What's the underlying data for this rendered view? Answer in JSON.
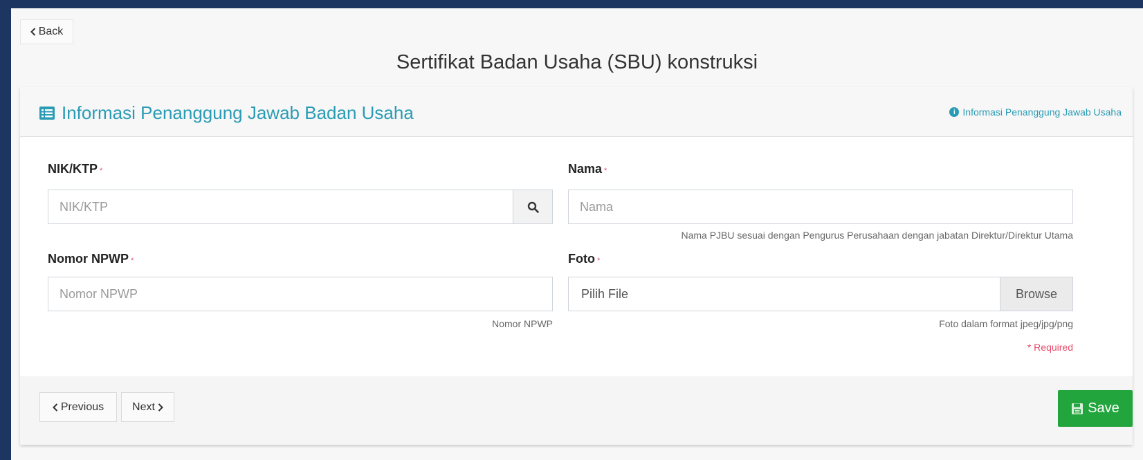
{
  "back": {
    "label": "Back"
  },
  "page": {
    "title": "Sertifikat Badan Usaha (SBU) konstruksi"
  },
  "section": {
    "title": "Informasi Penanggung Jawab Badan Usaha",
    "info_link": "Informasi Penanggung Jawab Usaha"
  },
  "form": {
    "nik": {
      "label": "NIK/KTP",
      "placeholder": "NIK/KTP"
    },
    "nama": {
      "label": "Nama",
      "placeholder": "Nama",
      "help": "Nama PJBU sesuai dengan Pengurus Perusahaan dengan jabatan Direktur/Direktur Utama"
    },
    "npwp": {
      "label": "Nomor NPWP",
      "placeholder": "Nomor NPWP",
      "help": "Nomor NPWP"
    },
    "foto": {
      "label": "Foto",
      "file_text": "Pilih File",
      "browse_label": "Browse",
      "help": "Foto dalam format jpeg/jpg/png"
    },
    "required_star": "*",
    "required_note": "* Required"
  },
  "footer": {
    "previous_label": "Previous",
    "next_label": "Next",
    "save_label": "Save"
  },
  "colors": {
    "background": "#1c3561",
    "accent": "#2a9bb4",
    "save": "#22a53c",
    "required": "#e64a6a"
  }
}
